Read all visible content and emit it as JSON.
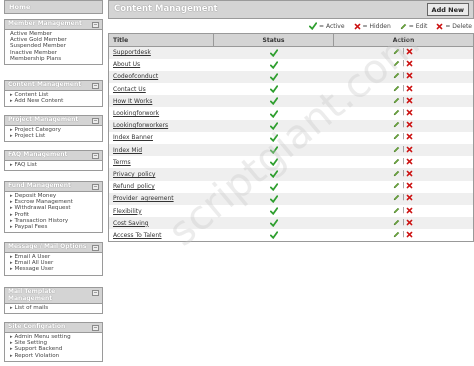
{
  "sidebar": {
    "home": "Home",
    "sections": [
      {
        "title": "Member Management",
        "toggle": "−",
        "items": [
          "Active Member",
          "Active Gold Member",
          "Suspended Member",
          "Inactive Member",
          "Membership Plans"
        ],
        "arrows": false
      },
      {
        "title": "Content Management",
        "toggle": "−",
        "items": [
          "Content List",
          "Add New Content"
        ],
        "arrows": true
      },
      {
        "title": "Project Management",
        "toggle": "−",
        "items": [
          "Project Category",
          "Project List"
        ],
        "arrows": true
      },
      {
        "title": "FAQ Management",
        "toggle": "−",
        "items": [
          "FAQ List"
        ],
        "arrows": true
      },
      {
        "title": "Fund Management",
        "toggle": "−",
        "items": [
          "Deposit Money",
          "Escrow Management",
          "Withdrawal Request",
          "Profit",
          "Transaction History",
          "Paypal Fees"
        ],
        "arrows": true
      },
      {
        "title": "Message / Mail Options",
        "toggle": "−",
        "items": [
          "Email A User",
          "Email All User",
          "Message User"
        ],
        "arrows": true
      },
      {
        "title": "Mail Template Management",
        "toggle": "−",
        "items": [
          "List of mails"
        ],
        "arrows": true
      },
      {
        "title": "Site Configration",
        "toggle": "−",
        "items": [
          "Admin Menu setting",
          "Site Setting",
          "Support Backend",
          "Report Violation"
        ],
        "arrows": true
      }
    ]
  },
  "main": {
    "title": "Content Management",
    "add_button": "Add New",
    "legend": {
      "active": "= Active",
      "hidden": "= Hidden",
      "edit": "= Edit",
      "delete": "= Delete"
    },
    "columns": {
      "title": "Title",
      "status": "Status",
      "action": "Action"
    },
    "rows": [
      "Supportdesk",
      "About Us",
      "Codeofconduct",
      "Contact Us",
      "How It Works",
      "Lookingforwork",
      "Lookingforworkers",
      "Index Banner",
      "Index Mid",
      "Terms",
      "Privacy_policy",
      "Refund_policy",
      "Provider_agreement",
      "Flexibility",
      "Cost Saving",
      "Access To Talent"
    ],
    "action_separator": "|"
  },
  "watermark": "scriptgiant.com",
  "colors": {
    "header_bg": "#d4d4d4",
    "check": "#2e9e2e",
    "delete": "#cc1111",
    "edit": "#4a8a2a"
  }
}
